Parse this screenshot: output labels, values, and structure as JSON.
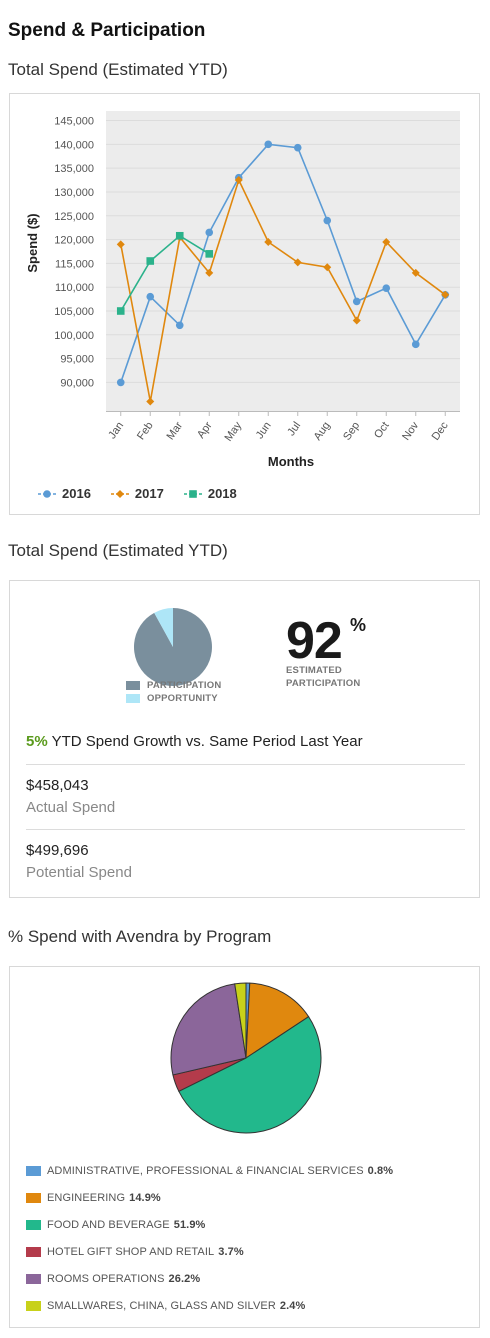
{
  "page": {
    "title": "Spend & Participation",
    "section1_title": "Total Spend (Estimated YTD)",
    "section2_title": "Total Spend (Estimated YTD)",
    "section3_title": "% Spend with Avendra by Program"
  },
  "chart_data": [
    {
      "type": "line",
      "xlabel": "Months",
      "ylabel": "Spend ($)",
      "categories": [
        "Jan",
        "Feb",
        "Mar",
        "Apr",
        "May",
        "Jun",
        "Jul",
        "Aug",
        "Sep",
        "Oct",
        "Nov",
        "Dec"
      ],
      "ylim": [
        84000,
        147000
      ],
      "yticks": [
        90000,
        95000,
        100000,
        105000,
        110000,
        115000,
        120000,
        125000,
        130000,
        135000,
        140000,
        145000
      ],
      "ytick_labels": [
        "90,000",
        "95,000",
        "100,000",
        "105,000",
        "110,000",
        "115,000",
        "120,000",
        "125,000",
        "130,000",
        "135,000",
        "140,000",
        "145,000"
      ],
      "grid": true,
      "legend": "bottom",
      "series": [
        {
          "name": "2016",
          "color": "#5b9bd5",
          "marker": "circle",
          "values": [
            90000,
            108000,
            102000,
            121500,
            133000,
            140000,
            139300,
            124000,
            107000,
            109800,
            98000,
            108400
          ]
        },
        {
          "name": "2017",
          "color": "#e0880e",
          "marker": "diamond",
          "values": [
            119000,
            86000,
            120500,
            113000,
            132500,
            119500,
            115200,
            114200,
            103000,
            119500,
            113000,
            108400
          ]
        },
        {
          "name": "2018",
          "color": "#2bb28b",
          "marker": "square",
          "values": [
            105000,
            115500,
            120800,
            117000,
            null,
            null,
            null,
            null,
            null,
            null,
            null,
            null
          ]
        }
      ]
    },
    {
      "type": "pie",
      "slices": [
        {
          "label": "PARTICIPATION",
          "value": 92,
          "color": "#7a8f9d"
        },
        {
          "label": "OPPORTUNITY",
          "value": 8,
          "color": "#aee6f7"
        }
      ]
    },
    {
      "type": "pie",
      "slices": [
        {
          "label": "ADMINISTRATIVE, PROFESSIONAL & FINANCIAL SERVICES",
          "value": 0.8,
          "pct_label": "0.8%",
          "color": "#5b9bd5"
        },
        {
          "label": "ENGINEERING",
          "value": 14.9,
          "pct_label": "14.9%",
          "color": "#e0880e"
        },
        {
          "label": "FOOD AND BEVERAGE",
          "value": 51.9,
          "pct_label": "51.9%",
          "color": "#22b88c"
        },
        {
          "label": "HOTEL GIFT SHOP AND RETAIL",
          "value": 3.7,
          "pct_label": "3.7%",
          "color": "#b43b4b"
        },
        {
          "label": "ROOMS OPERATIONS",
          "value": 26.2,
          "pct_label": "26.2%",
          "color": "#8b669a"
        },
        {
          "label": "SMALLWARES, CHINA, GLASS AND SILVER",
          "value": 2.4,
          "pct_label": "2.4%",
          "color": "#c8d11a"
        }
      ]
    }
  ],
  "participation": {
    "percent": "92",
    "percent_sign": "%",
    "label": "ESTIMATED PARTICIPATION",
    "growth_pct": "5%",
    "growth_text": " YTD Spend Growth vs. Same Period Last Year",
    "actual_value": "$458,043",
    "actual_label": "Actual Spend",
    "potential_value": "$499,696",
    "potential_label": "Potential Spend"
  }
}
